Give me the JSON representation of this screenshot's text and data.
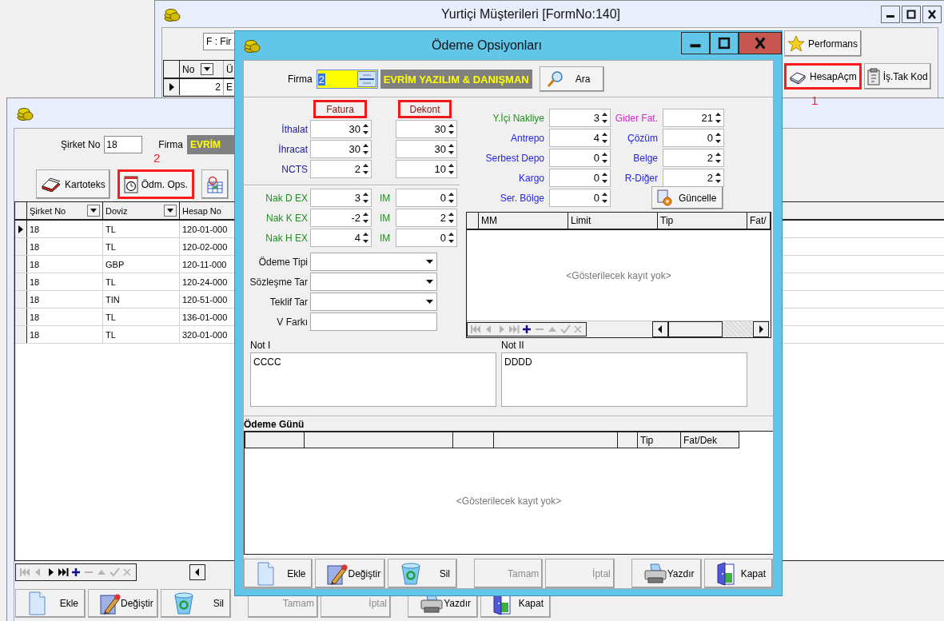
{
  "customers_window": {
    "title": "Yurtiçi Müşterileri [FormNo:140]",
    "filter": {
      "value": "F : Fir"
    },
    "grid": {
      "columns": [
        {
          "label": "No",
          "filter": true
        },
        {
          "label": "Ü",
          "filter": false
        }
      ],
      "rows": [
        {
          "cells": [
            "2",
            "E"
          ],
          "selected": true
        }
      ]
    },
    "buttons": [
      {
        "label": "Performans",
        "highlighted": false
      },
      {
        "label": "HesapAçm",
        "highlighted": true
      },
      {
        "label": "İş.Tak Kod",
        "highlighted": false
      }
    ],
    "annotation": "1"
  },
  "accounts_window": {
    "fields": [
      {
        "label": "Şirket No",
        "value": "18"
      }
    ],
    "firm": {
      "label": "Firma",
      "value": "EVRİM"
    },
    "annotation": "2",
    "buttons": [
      {
        "label": "Kartoteks",
        "highlighted": false
      },
      {
        "label": "Ödm. Ops.",
        "highlighted": true
      },
      {
        "highlighted": false
      }
    ],
    "grid": {
      "columns": [
        {
          "label": "Şirket No",
          "filter": true
        },
        {
          "label": "Doviz",
          "filter": true
        },
        {
          "label": "Hesap No",
          "filter": false
        }
      ],
      "rows": [
        {
          "cells": [
            "18",
            "TL",
            "120-01-000"
          ],
          "selected": true
        },
        {
          "cells": [
            "18",
            "TL",
            "120-02-000"
          ],
          "selected": false
        },
        {
          "cells": [
            "18",
            "GBP",
            "120-11-000"
          ],
          "selected": false
        },
        {
          "cells": [
            "18",
            "TL",
            "120-24-000"
          ],
          "selected": false
        },
        {
          "cells": [
            "18",
            "TIN",
            "120-51-000"
          ],
          "selected": false
        },
        {
          "cells": [
            "18",
            "TL",
            "136-01-000"
          ],
          "selected": false
        },
        {
          "cells": [
            "18",
            "TL",
            "320-01-000"
          ],
          "selected": false
        }
      ]
    },
    "navigator": [
      {
        "kind": "first",
        "enabled": false
      },
      {
        "kind": "prior",
        "enabled": false
      },
      {
        "kind": "next",
        "enabled": true
      },
      {
        "kind": "last",
        "enabled": true
      },
      {
        "kind": "insert",
        "enabled": true
      },
      {
        "kind": "delete",
        "enabled": false
      },
      {
        "kind": "edit",
        "enabled": false
      },
      {
        "kind": "post",
        "enabled": false
      },
      {
        "kind": "cancel",
        "enabled": false
      }
    ],
    "actions": [
      {
        "label": "Ekle",
        "disabled": false
      },
      {
        "label": "Değiştir",
        "disabled": false
      },
      {
        "label": "Sil",
        "disabled": false
      },
      {
        "label": "Tamam",
        "disabled": true
      },
      {
        "label": "İptal",
        "disabled": true
      },
      {
        "label": "Yazdır",
        "disabled": false
      },
      {
        "label": "Kapat",
        "disabled": false
      }
    ]
  },
  "payment_dialog": {
    "title": "Ödeme Opsiyonları",
    "firm": {
      "label": "Firma",
      "code": "2",
      "name": "EVRİM YAZILIM & DANIŞMAN"
    },
    "search_button": {
      "label": "Ara"
    },
    "column_headers": [
      {
        "label": "Fatura",
        "highlighted": true
      },
      {
        "label": "Dekont",
        "highlighted": true
      }
    ],
    "document_rows": [
      {
        "label": "İthalat",
        "color": "#1c1c9a",
        "invoice": "30",
        "receipt": "30"
      },
      {
        "label": "İhracat",
        "color": "#1c1c9a",
        "invoice": "30",
        "receipt": "30"
      },
      {
        "label": "NCTS",
        "color": "#1c1c9a",
        "invoice": "2",
        "receipt": "10"
      }
    ],
    "transport_rows": [
      {
        "label": "Nak D EX",
        "color": "#1f8f1f",
        "value": "3",
        "im_label": "IM",
        "im_value": "0"
      },
      {
        "label": "Nak K EX",
        "color": "#1f8f1f",
        "value": "-2",
        "im_label": "IM",
        "im_value": "2"
      },
      {
        "label": "Nak H EX",
        "color": "#1f8f1f",
        "value": "4",
        "im_label": "IM",
        "im_value": "0"
      }
    ],
    "inputs": [
      {
        "label": "Ödeme Tipi",
        "kind": "dropdown"
      },
      {
        "label": "Sözleşme Tar",
        "kind": "dropdown"
      },
      {
        "label": "Teklif Tar",
        "kind": "dropdown"
      },
      {
        "label": "V Farkı",
        "kind": "text"
      }
    ],
    "cost_rows": [
      {
        "label": "Y.İçi Nakliye",
        "color": "#1f8f1f",
        "value": "3"
      },
      {
        "label": "Antrepo",
        "color": "#2424e8",
        "value": "4"
      },
      {
        "label": "Serbest Depo",
        "color": "#2424e8",
        "value": "0"
      },
      {
        "label": "Kargo",
        "color": "#2424e8",
        "value": "0"
      },
      {
        "label": "Ser. Bölge",
        "color": "#2424e8",
        "value": "0"
      }
    ],
    "extra_rows": [
      {
        "label": "Gider Fat.",
        "color": "#e020e0",
        "value": "21"
      },
      {
        "label": "Çözüm",
        "color": "#2424e8",
        "value": "0"
      },
      {
        "label": "Belge",
        "color": "#2424e8",
        "value": "2"
      },
      {
        "label": "R-Diğer",
        "color": "#2424e8",
        "value": "2"
      }
    ],
    "update_button": {
      "label": "Güncelle"
    },
    "limits_grid": {
      "columns": [
        "MM",
        "Limit",
        "Tip",
        "Fat/"
      ],
      "empty_text": "<Gösterilecek kayıt yok>",
      "navigator": [
        {
          "kind": "first",
          "enabled": false
        },
        {
          "kind": "prior",
          "enabled": false
        },
        {
          "kind": "next",
          "enabled": false
        },
        {
          "kind": "last",
          "enabled": false
        },
        {
          "kind": "insert",
          "enabled": true
        },
        {
          "kind": "delete",
          "enabled": false
        },
        {
          "kind": "edit",
          "enabled": false
        },
        {
          "kind": "post",
          "enabled": false
        },
        {
          "kind": "cancel",
          "enabled": false
        }
      ]
    },
    "notes": [
      {
        "label": "Not I",
        "value": "CCCC"
      },
      {
        "label": "Not II",
        "value": "DDDD"
      }
    ],
    "payment_days": {
      "title": "Ödeme Günü",
      "columns": [
        "Tip",
        "Fat/Dek"
      ],
      "empty_text": "<Gösterilecek kayıt yok>"
    },
    "actions": [
      {
        "label": "Ekle",
        "disabled": false
      },
      {
        "label": "Değiştir",
        "disabled": false
      },
      {
        "label": "Sil",
        "disabled": false
      },
      {
        "label": "Tamam",
        "disabled": true
      },
      {
        "label": "İptal",
        "disabled": true
      },
      {
        "label": "Yazdır",
        "disabled": false
      },
      {
        "label": "Kapat",
        "disabled": false
      }
    ]
  }
}
